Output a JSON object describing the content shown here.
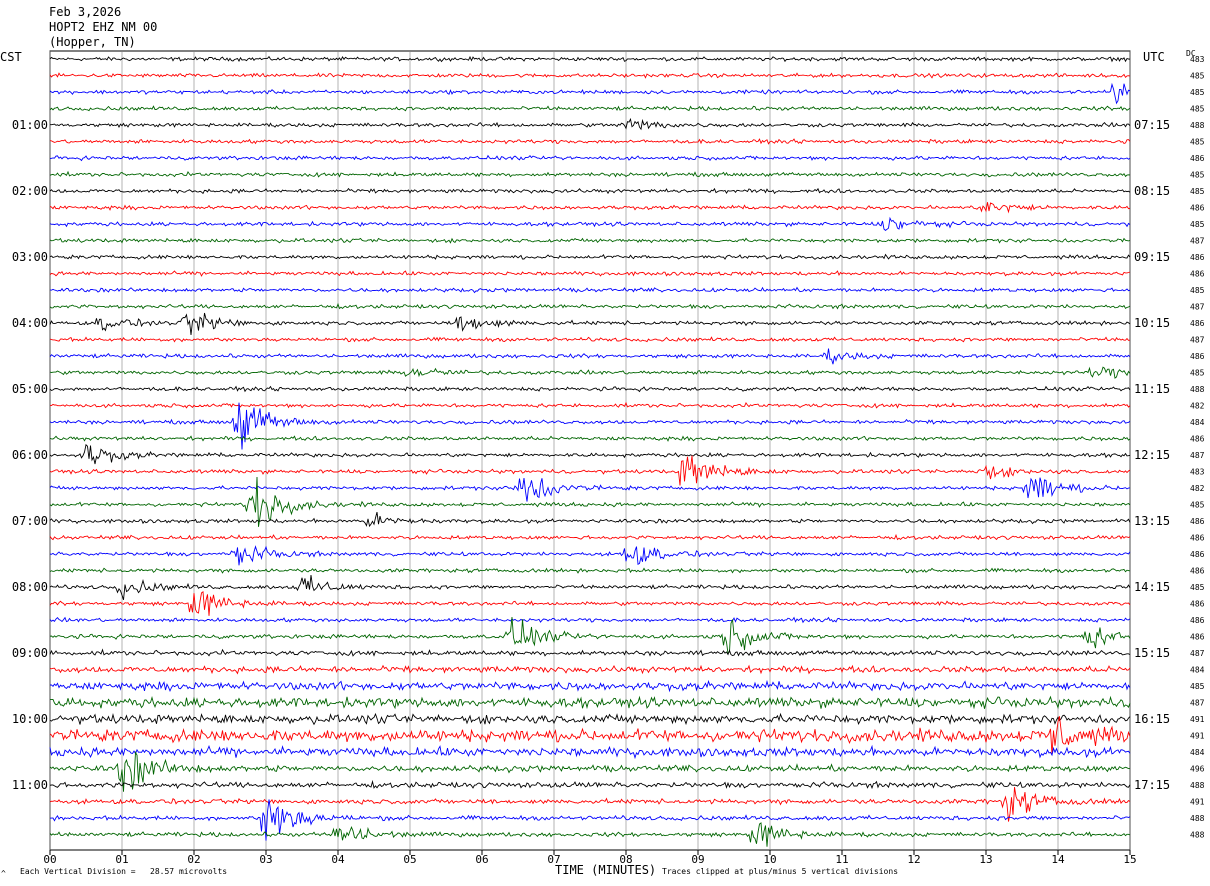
{
  "header": {
    "date": "Feb 3,2026",
    "station": "HOPT2 EHZ NM 00",
    "location": "(Hopper, TN)",
    "left_tz": "CST",
    "right_tz": "UTC",
    "dc_label": "DC"
  },
  "footer": {
    "division_note": "Each Vertical Division =   28.57 microvolts",
    "clip_note": "Traces clipped at plus/minus 5 vertical divisions",
    "mark": "^"
  },
  "colors": {
    "cycle": [
      "#000000",
      "#ff0000",
      "#0000ff",
      "#006400"
    ],
    "grid": "#808080"
  },
  "chart_data": {
    "type": "line",
    "title": "Feb 3,2026  HOPT2 EHZ NM 00 (Hopper, TN)",
    "xlabel": "TIME (MINUTES)",
    "ylabel": "",
    "xlim": [
      0,
      15
    ],
    "x_ticks": [
      "00",
      "01",
      "02",
      "03",
      "04",
      "05",
      "06",
      "07",
      "08",
      "09",
      "10",
      "11",
      "12",
      "13",
      "14",
      "15"
    ],
    "trace_count": 48,
    "minutes_per_trace": 15,
    "left_hour_labels": [
      "01:00",
      "02:00",
      "03:00",
      "04:00",
      "05:00",
      "06:00",
      "07:00",
      "08:00",
      "09:00",
      "10:00",
      "11:00"
    ],
    "right_hour_labels": [
      "07:15",
      "08:15",
      "09:15",
      "10:15",
      "11:15",
      "12:15",
      "13:15",
      "14:15",
      "15:15",
      "16:15",
      "17:15"
    ],
    "dc_offsets": [
      483,
      485,
      485,
      485,
      488,
      485,
      486,
      485,
      485,
      486,
      485,
      487,
      486,
      486,
      485,
      487,
      486,
      487,
      486,
      485,
      488,
      482,
      484,
      486,
      487,
      483,
      482,
      485,
      486,
      486,
      486,
      486,
      485,
      486,
      486,
      486,
      487,
      484,
      485,
      487,
      491,
      491,
      484,
      496,
      488,
      491,
      488,
      488
    ],
    "noise_level": [
      0.28,
      0.28,
      0.28,
      0.28,
      0.28,
      0.28,
      0.28,
      0.28,
      0.28,
      0.28,
      0.28,
      0.28,
      0.28,
      0.28,
      0.28,
      0.28,
      0.28,
      0.28,
      0.28,
      0.28,
      0.28,
      0.28,
      0.28,
      0.28,
      0.28,
      0.28,
      0.28,
      0.28,
      0.28,
      0.28,
      0.28,
      0.28,
      0.28,
      0.28,
      0.28,
      0.3,
      0.35,
      0.45,
      0.6,
      0.7,
      0.65,
      0.9,
      0.65,
      0.45,
      0.4,
      0.35,
      0.32,
      0.3
    ],
    "events": [
      {
        "trace": 2,
        "minute": 14.8,
        "amplitude": 1.8
      },
      {
        "trace": 4,
        "minute": 8.0,
        "amplitude": 1.2
      },
      {
        "trace": 9,
        "minute": 13.0,
        "amplitude": 1.2
      },
      {
        "trace": 10,
        "minute": 11.6,
        "amplitude": 1.4
      },
      {
        "trace": 16,
        "minute": 0.7,
        "amplitude": 1.2
      },
      {
        "trace": 16,
        "minute": 1.9,
        "amplitude": 2.2
      },
      {
        "trace": 16,
        "minute": 5.7,
        "amplitude": 1.8
      },
      {
        "trace": 18,
        "minute": 10.8,
        "amplitude": 1.0
      },
      {
        "trace": 19,
        "minute": 5.0,
        "amplitude": 1.0
      },
      {
        "trace": 19,
        "minute": 14.5,
        "amplitude": 1.2
      },
      {
        "trace": 22,
        "minute": 2.6,
        "amplitude": 5.0
      },
      {
        "trace": 24,
        "minute": 0.5,
        "amplitude": 2.0
      },
      {
        "trace": 25,
        "minute": 8.8,
        "amplitude": 4.0
      },
      {
        "trace": 25,
        "minute": 12.9,
        "amplitude": 1.5
      },
      {
        "trace": 26,
        "minute": 6.5,
        "amplitude": 4.0
      },
      {
        "trace": 26,
        "minute": 13.6,
        "amplitude": 3.0
      },
      {
        "trace": 27,
        "minute": 2.8,
        "amplitude": 5.0
      },
      {
        "trace": 28,
        "minute": 4.4,
        "amplitude": 1.4
      },
      {
        "trace": 30,
        "minute": 2.6,
        "amplitude": 2.0
      },
      {
        "trace": 30,
        "minute": 8.0,
        "amplitude": 2.5
      },
      {
        "trace": 32,
        "minute": 1.0,
        "amplitude": 1.5
      },
      {
        "trace": 32,
        "minute": 3.5,
        "amplitude": 1.8
      },
      {
        "trace": 33,
        "minute": 2.0,
        "amplitude": 3.0
      },
      {
        "trace": 35,
        "minute": 6.4,
        "amplitude": 3.0
      },
      {
        "trace": 35,
        "minute": 9.4,
        "amplitude": 3.0
      },
      {
        "trace": 35,
        "minute": 14.4,
        "amplitude": 2.0
      },
      {
        "trace": 41,
        "minute": 13.9,
        "amplitude": 3.5
      },
      {
        "trace": 43,
        "minute": 1.0,
        "amplitude": 4.0
      },
      {
        "trace": 45,
        "minute": 13.3,
        "amplitude": 3.0
      },
      {
        "trace": 46,
        "minute": 3.0,
        "amplitude": 5.0
      },
      {
        "trace": 47,
        "minute": 4.0,
        "amplitude": 2.5
      },
      {
        "trace": 47,
        "minute": 9.8,
        "amplitude": 2.5
      }
    ]
  }
}
